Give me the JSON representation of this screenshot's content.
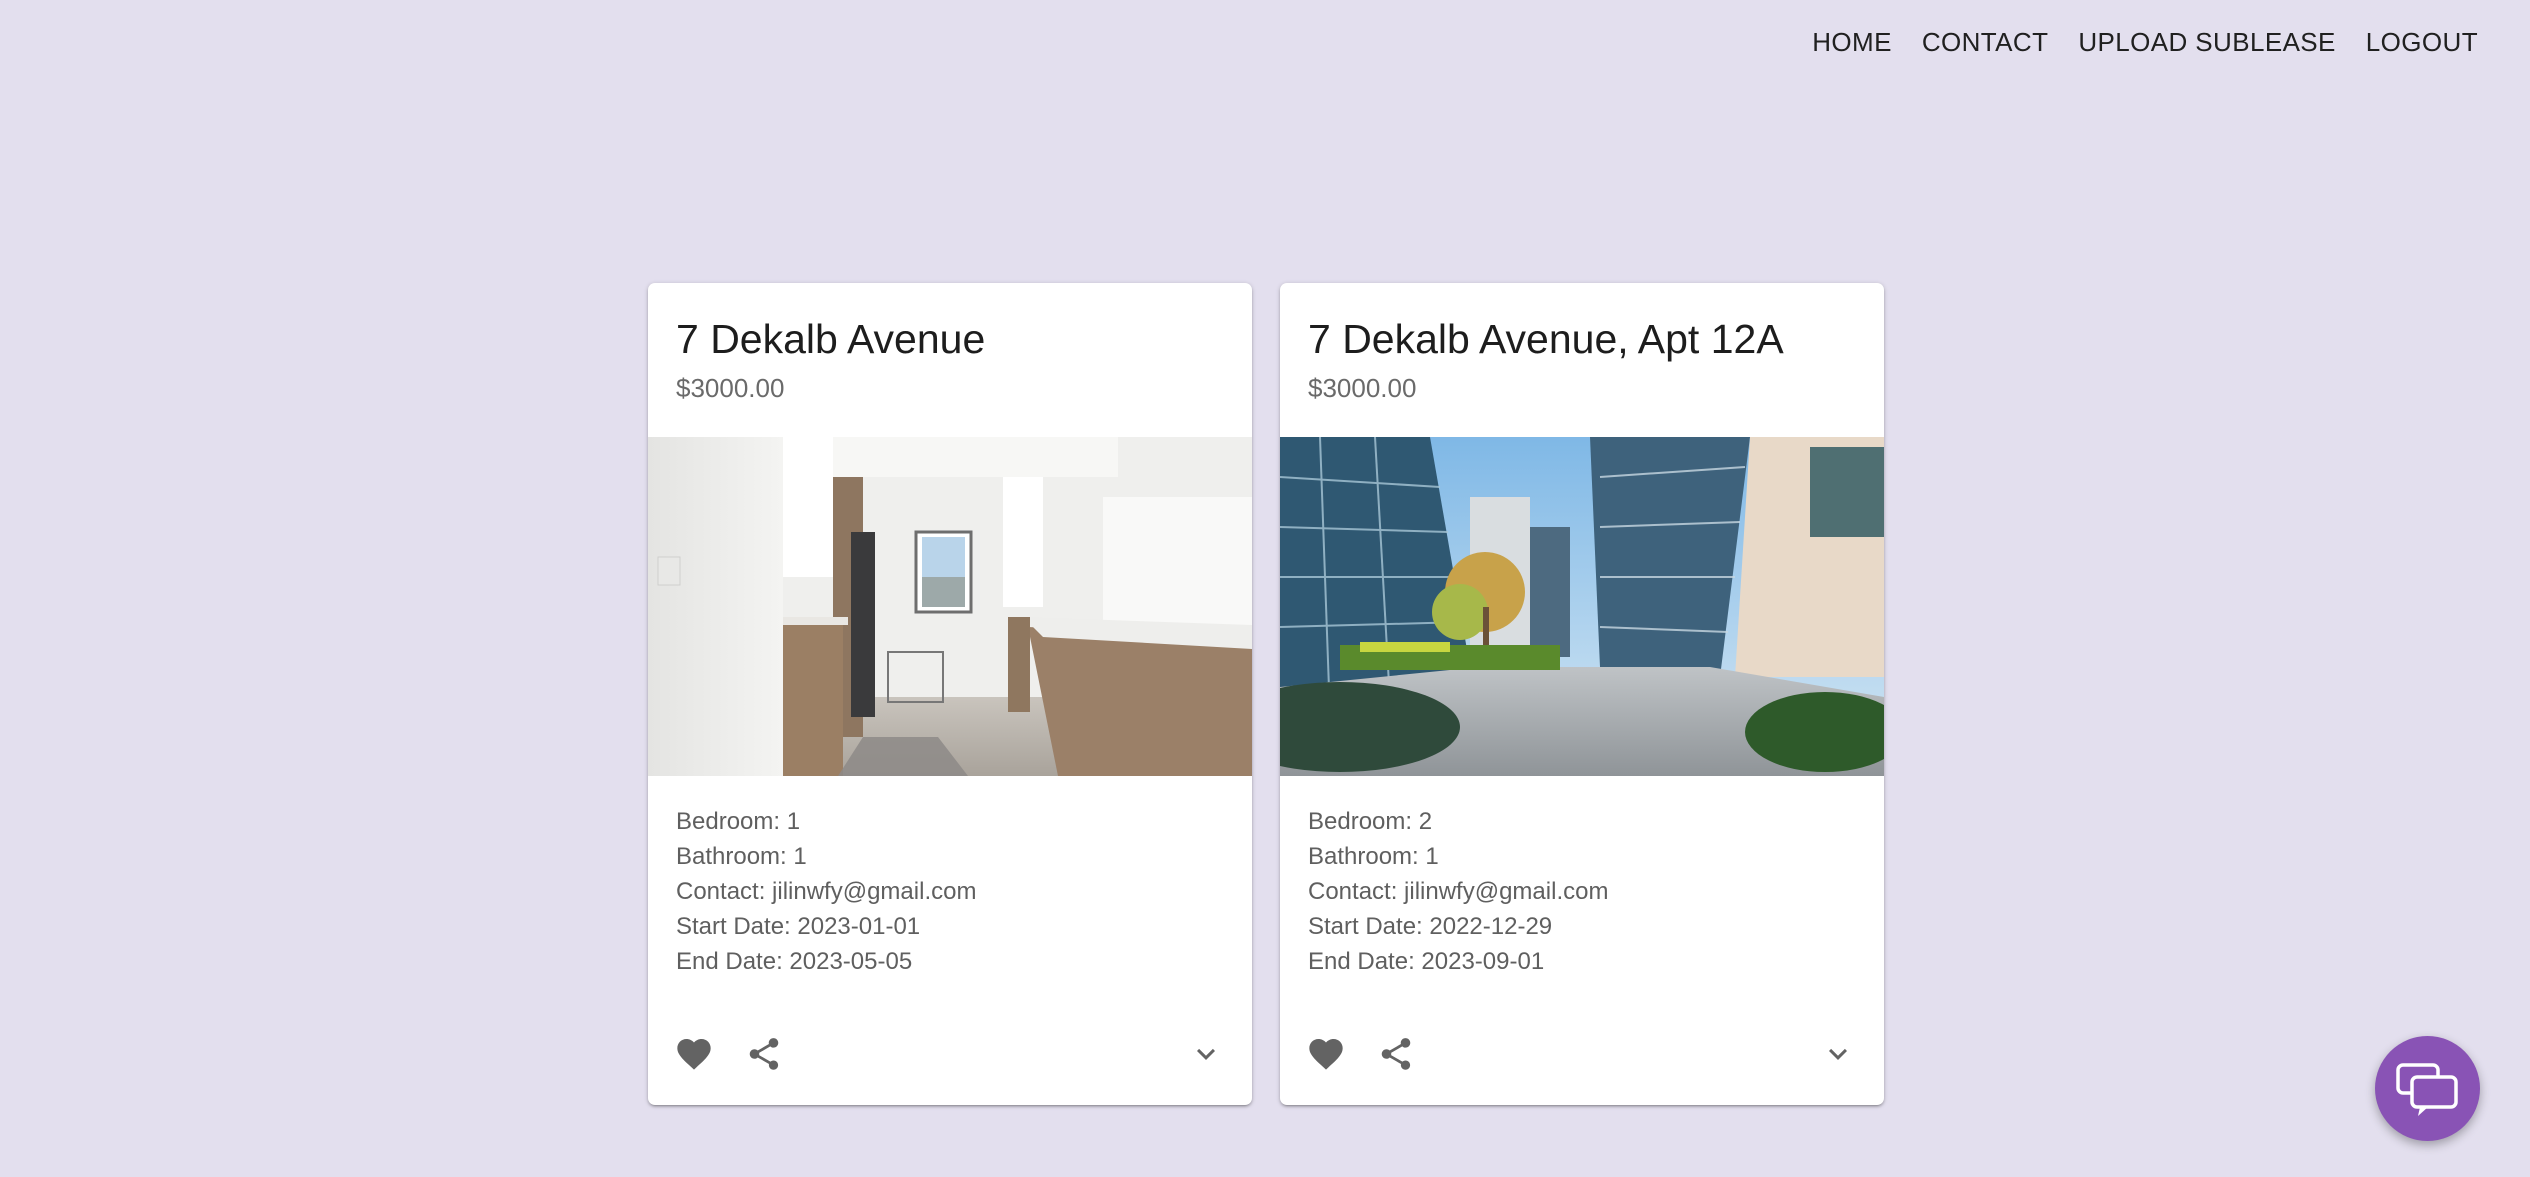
{
  "nav": {
    "home": "HOME",
    "contact": "CONTACT",
    "upload": "UPLOAD SUBLEASE",
    "logout": "LOGOUT"
  },
  "listings": [
    {
      "title": "7 Dekalb Avenue",
      "price": "$3000.00",
      "image_icon": "kitchen-photo",
      "bedroom": "Bedroom: 1",
      "bathroom": "Bathroom: 1",
      "contact": "Contact: jilinwfy@gmail.com",
      "start": "Start Date: 2023-01-01",
      "end": "End Date: 2023-05-05"
    },
    {
      "title": "7 Dekalb Avenue, Apt 12A",
      "price": "$3000.00",
      "image_icon": "apartment-courtyard-photo",
      "bedroom": "Bedroom: 2",
      "bathroom": "Bathroom: 1",
      "contact": "Contact: jilinwfy@gmail.com",
      "start": "Start Date: 2022-12-29",
      "end": "End Date: 2023-09-01"
    }
  ],
  "colors": {
    "background": "#e3dfee",
    "fab": "#8953b5",
    "icon": "#636363"
  },
  "chat_icon": "chat-bubbles-icon"
}
